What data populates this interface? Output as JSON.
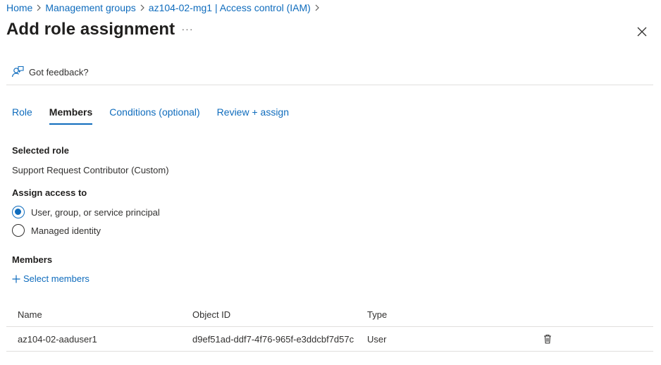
{
  "breadcrumb": [
    {
      "label": "Home"
    },
    {
      "label": "Management groups"
    },
    {
      "label": "az104-02-mg1 | Access control (IAM)"
    }
  ],
  "header": {
    "title": "Add role assignment",
    "more_label": "···"
  },
  "feedback": {
    "label": "Got feedback?",
    "icon": "feedback-person-icon"
  },
  "tabs": [
    {
      "label": "Role",
      "active": false
    },
    {
      "label": "Members",
      "active": true
    },
    {
      "label": "Conditions (optional)",
      "active": false
    },
    {
      "label": "Review + assign",
      "active": false
    }
  ],
  "selected_role": {
    "heading": "Selected role",
    "value": "Support Request Contributor (Custom)"
  },
  "assign_access": {
    "heading": "Assign access to",
    "options": [
      {
        "label": "User, group, or service principal",
        "checked": true
      },
      {
        "label": "Managed identity",
        "checked": false
      }
    ]
  },
  "members": {
    "heading": "Members",
    "select_label": "Select members",
    "columns": [
      "Name",
      "Object ID",
      "Type"
    ],
    "rows": [
      {
        "name": "az104-02-aaduser1",
        "object_id": "d9ef51ad-ddf7-4f76-965f-e3ddcbf7d57c",
        "type": "User"
      }
    ]
  },
  "colors": {
    "accent": "#0f6cbd",
    "text": "#323130",
    "divider": "#e1dfdd"
  }
}
